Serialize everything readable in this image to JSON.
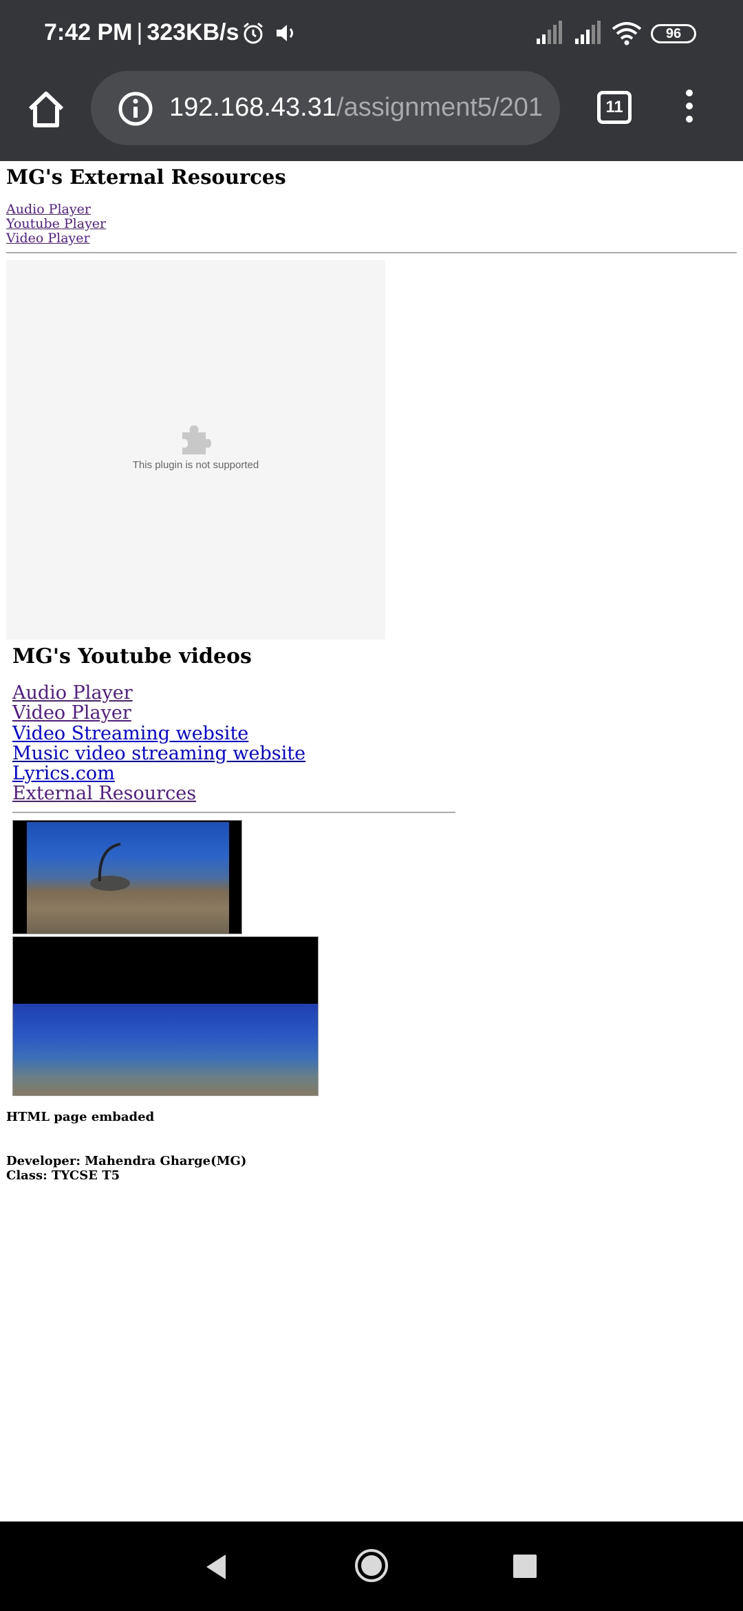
{
  "status_bar": {
    "time": "7:42 PM",
    "separator": "|",
    "speed": "323KB/s",
    "battery": "96"
  },
  "browser": {
    "url_host": "192.168.43.31",
    "url_path": "/assignment5/201",
    "tab_count": "11"
  },
  "page": {
    "heading": "MG's External Resources",
    "small_links": [
      "Audio Player",
      "Youtube Player",
      "Video Player"
    ],
    "plugin_message": "This plugin is not supported",
    "youtube_heading": "MG's Youtube videos",
    "big_links": [
      "Audio Player",
      "Video Player",
      "Video Streaming website",
      "Music video streaming website",
      "Lyrics.com",
      "External Resources"
    ],
    "embed_label": "HTML page embaded",
    "developer": "Developer: Mahendra Gharge(MG)",
    "class_info": "Class: TYCSE T5"
  }
}
